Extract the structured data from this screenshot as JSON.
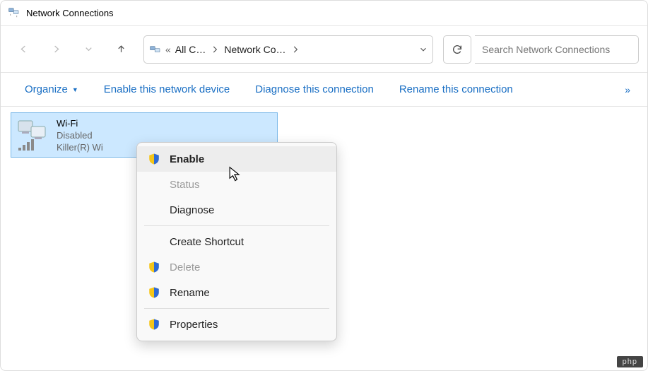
{
  "window": {
    "title": "Network Connections"
  },
  "breadcrumb": {
    "item1": "All C…",
    "item2": "Network Co…"
  },
  "search": {
    "placeholder": "Search Network Connections"
  },
  "toolbar": {
    "organize": "Organize",
    "enable_device": "Enable this network device",
    "diagnose": "Diagnose this connection",
    "rename": "Rename this connection"
  },
  "adapter": {
    "name": "Wi-Fi",
    "status": "Disabled",
    "device": "Killer(R) Wi"
  },
  "context_menu": {
    "enable": "Enable",
    "status": "Status",
    "diagnose": "Diagnose",
    "create_shortcut": "Create Shortcut",
    "delete": "Delete",
    "rename": "Rename",
    "properties": "Properties"
  },
  "watermark": "php"
}
